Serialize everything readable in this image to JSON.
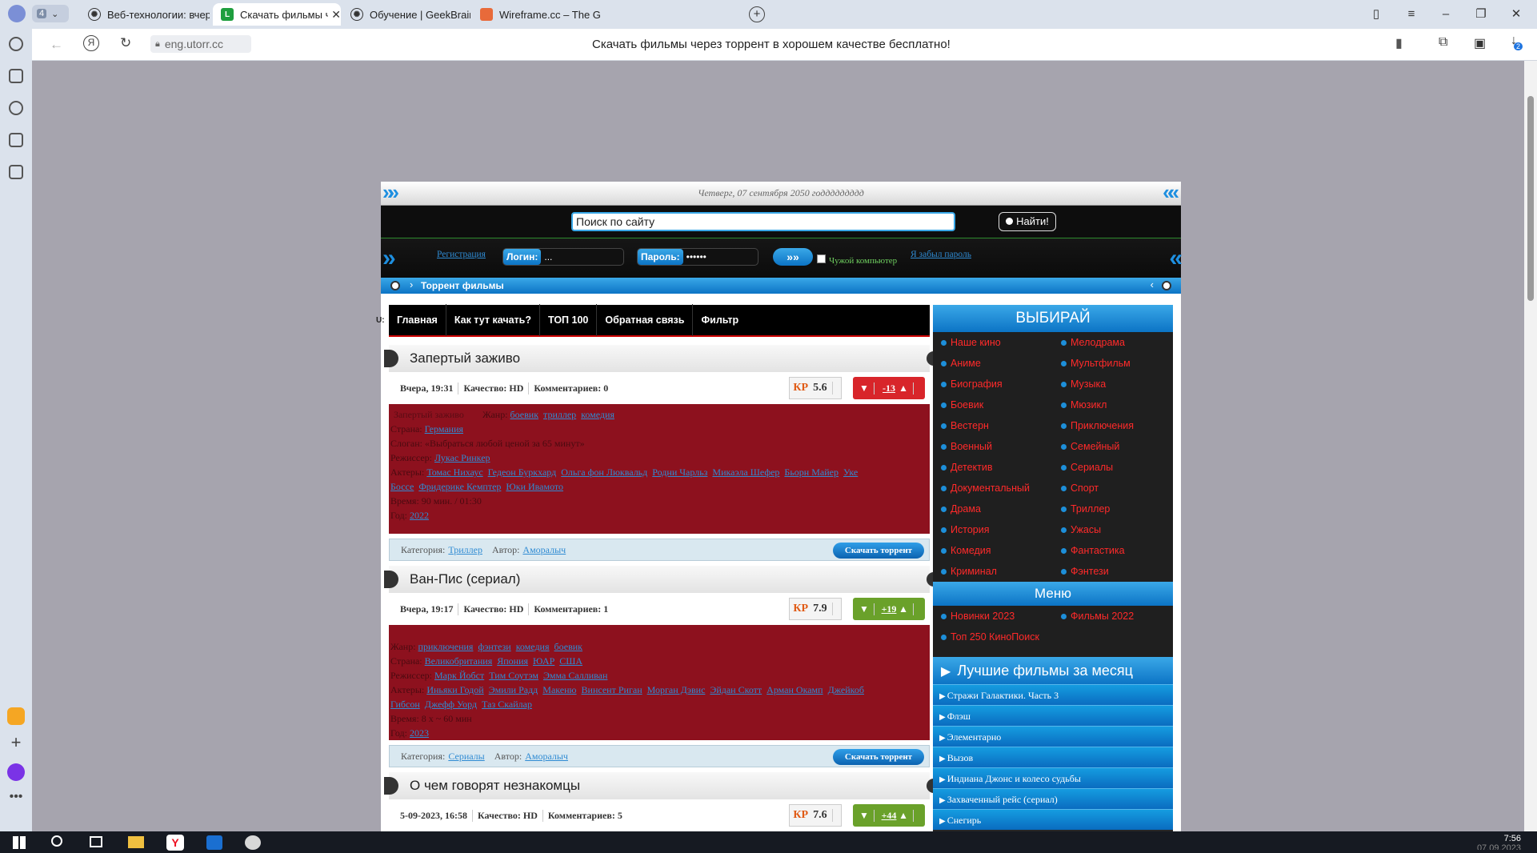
{
  "browser": {
    "tab_count": "4",
    "tabs": [
      {
        "title": "Веб-технологии: вчера, се",
        "favicon": "openai-icon",
        "active": false
      },
      {
        "title": "Скачать фильмы через",
        "favicon": "utorr-icon",
        "active": true
      },
      {
        "title": "Обучение | GeekBrains - о",
        "favicon": "geekbrains-icon",
        "active": false
      },
      {
        "title": "Wireframe.cc – The Go-to",
        "favicon": "wireframe-icon",
        "active": false
      }
    ],
    "url": "eng.utorr.cc",
    "page_title": "Скачать фильмы через торрент в хорошем качестве бесплатно!",
    "download_badge": "2"
  },
  "taskbar": {
    "time": "7:56",
    "date": "07.09.2023"
  },
  "site": {
    "date_line": "Четверг, 07 сентября 2050 годдддддддд",
    "search_placeholder": "Поиск по сайту",
    "search_button": "Найти!",
    "register": "Регистрация",
    "login_label": "Логин:",
    "login_value": "...",
    "password_label": "Пароль:",
    "password_value": "••••••",
    "foreign_pc": "Чужой компьютер",
    "forgot": "Я забыл пароль",
    "breadcrumb": "Торрент фильмы",
    "nav": [
      "Главная",
      "Как тут качать?",
      "ТОП 100",
      "Обратная связь",
      "Фильтр"
    ],
    "nav_stub": "U:",
    "articles": [
      {
        "title": "Запертый заживо",
        "date": "Вчера, 19:31",
        "quality": "Качество: HD",
        "comments": "Комментариев: 0",
        "kp_label": "КР",
        "kp": "5.6",
        "vote": "-13",
        "vote_color": "#d8252a",
        "poster_alt": "Запертый заживо",
        "genre_label": "Жанр:",
        "genres": [
          "боевик",
          "триллер",
          "комедия"
        ],
        "country_label": "Страна:",
        "countries": [
          "Германия"
        ],
        "slogan": "Слоган: «Выбраться любой ценой за 65 минут»",
        "director_label": "Режиссер:",
        "directors": [
          "Лукас Ринкер"
        ],
        "actors_label": "Актеры:",
        "actors": [
          "Томас Нихаус",
          "Гедеон Буркхард",
          "Ольга фон Люквальд",
          "Родни Чарльз",
          "Микаэла Шефер",
          "Бьорн Майер",
          "Уке Боссе",
          "Фридерике Кемптер",
          "Юки Ивамото"
        ],
        "time": "Время: 90 мин. / 01:30",
        "year_label": "Год:",
        "year": "2022",
        "category_label": "Категория:",
        "category": "Триллер",
        "author_label": "Автор:",
        "author": "Аморалыч",
        "download": "Скачать торрент"
      },
      {
        "title": "Ван-Пис (сериал)",
        "date": "Вчера, 19:17",
        "quality": "Качество: HD",
        "comments": "Комментариев: 1",
        "kp_label": "КР",
        "kp": "7.9",
        "vote": "+19",
        "vote_color": "#6aa12a",
        "genre_label": "Жанр:",
        "genres": [
          "приключения",
          "фэнтези",
          "комедия",
          "боевик"
        ],
        "country_label": "Страна:",
        "countries": [
          "Великобритания",
          "Япония",
          "ЮАР",
          "США"
        ],
        "director_label": "Режиссер:",
        "directors": [
          "Марк Йобст",
          "Тим Соутэм",
          "Эмма Салливан"
        ],
        "actors_label": "Актеры:",
        "actors": [
          "Иньяки Годой",
          "Эмили Радд",
          "Макеню",
          "Винсент Риган",
          "Морган Дэвис",
          "Эйдан Скотт",
          "Арман Окамп",
          "Джейкоб Гибсон",
          "Джефф Уорд",
          "Таз Скайлар"
        ],
        "time": "Время: 8 x ~ 60 мин",
        "year_label": "Год:",
        "year": "2023",
        "category_label": "Категория:",
        "category": "Сериалы",
        "author_label": "Автор:",
        "author": "Аморалыч",
        "download": "Скачать торрент"
      },
      {
        "title": "О чем говорят незнакомцы",
        "date": "5-09-2023, 16:58",
        "quality": "Качество: HD",
        "comments": "Комментариев: 5",
        "kp_label": "КР",
        "kp": "7.6",
        "vote": "+44",
        "vote_color": "#6aa12a"
      }
    ],
    "sidebar": {
      "choose_title": "ВЫБИРАЙ",
      "genres_left": [
        "Наше кино",
        "Аниме",
        "Биография",
        "Боевик",
        "Вестерн",
        "Военный",
        "Детектив",
        "Документальный",
        "Драма",
        "История",
        "Комедия",
        "Криминал"
      ],
      "genres_right": [
        "Мелодрама",
        "Мультфильм",
        "Музыка",
        "Мюзикл",
        "Приключения",
        "Семейный",
        "Сериалы",
        "Спорт",
        "Триллер",
        "Ужасы",
        "Фантастика",
        "Фэнтези"
      ],
      "menu_title": "Меню",
      "menu": [
        "Новинки 2023",
        "Фильмы 2022",
        "Топ 250 КиноПоиск"
      ],
      "best_title": "Лучшие фильмы за месяц",
      "best": [
        "Стражи Галактики. Часть 3",
        "Флэш",
        "Элементарно",
        "Вызов",
        "Индиана Джонс и колесо судьбы",
        "Захваченный рейс (сериал)",
        "Снегирь"
      ]
    }
  }
}
